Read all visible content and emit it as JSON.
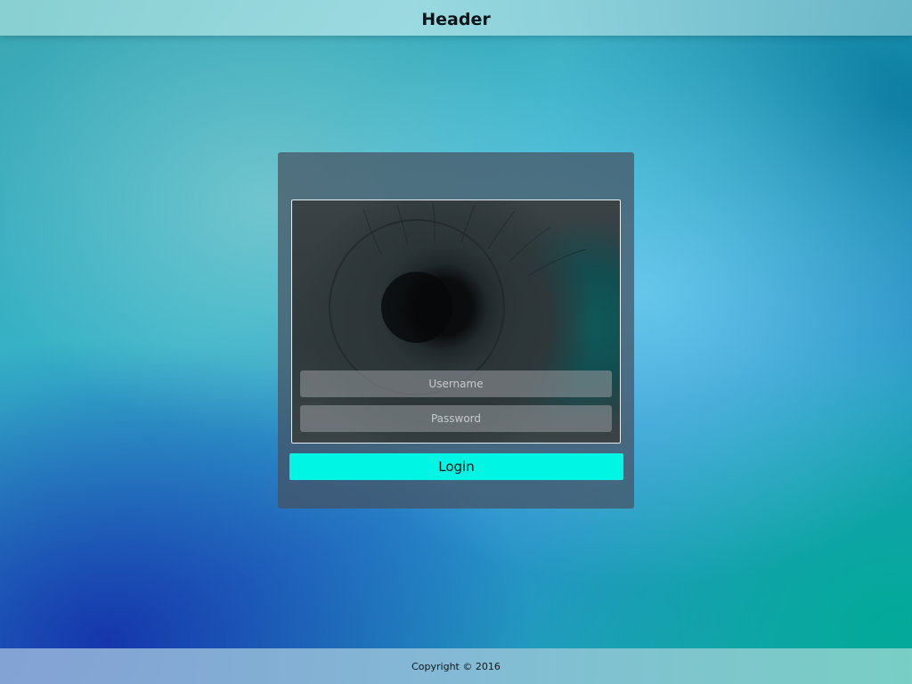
{
  "header": {
    "title": "Header"
  },
  "login_panel": {
    "image_icon": "eye-photo",
    "username_placeholder": "Username",
    "password_placeholder": "Password",
    "login_label": "Login"
  },
  "footer": {
    "copyright": "Copyright © 2016"
  },
  "colors": {
    "login_button": "#00f5e4",
    "panel_background": "#46505f",
    "text_dark": "#0b1418"
  }
}
